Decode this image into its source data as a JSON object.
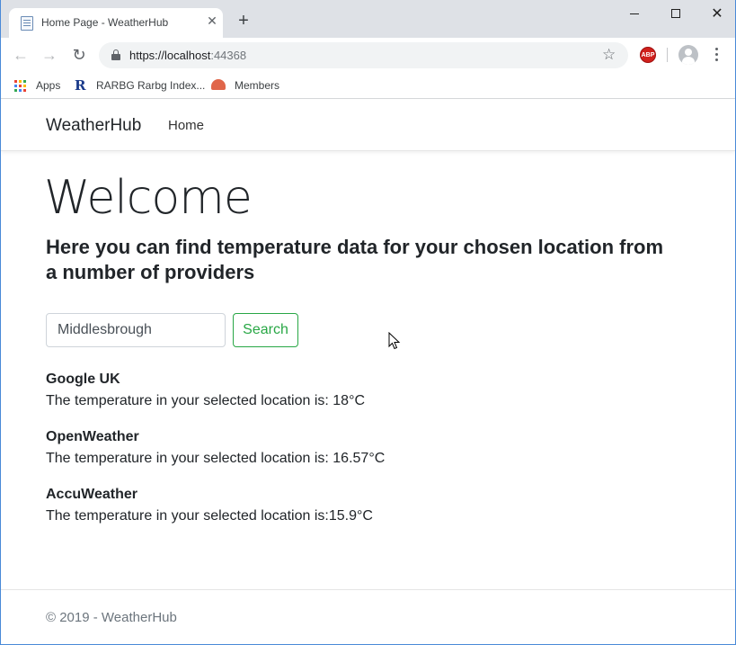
{
  "browser": {
    "tab_title": "Home Page - WeatherHub",
    "url_host": "https://localhost",
    "url_port": ":44368",
    "bookmarks": [
      {
        "label": "Apps",
        "icon": "apps-grid-icon"
      },
      {
        "label": "RARBG Rarbg Index...",
        "icon": "rarbg-icon"
      },
      {
        "label": "Members",
        "icon": "members-icon"
      }
    ],
    "extension_badge": "ABP",
    "colors": {
      "titlebar": "#dee1e6",
      "omnibox": "#f1f3f4",
      "abp": "#d0201c"
    }
  },
  "navbar": {
    "brand": "WeatherHub",
    "links": [
      {
        "label": "Home"
      }
    ]
  },
  "main": {
    "heading": "Welcome",
    "lead": "Here you can find temperature data for your chosen location from a number of providers",
    "search": {
      "value": "Middlesbrough",
      "button_label": "Search",
      "button_color": "#28a745"
    },
    "results": [
      {
        "provider": "Google UK",
        "text": "The temperature in your selected location is: 18°C"
      },
      {
        "provider": "OpenWeather",
        "text": "The temperature in your selected location is: 16.57°C"
      },
      {
        "provider": "AccuWeather",
        "text": "The temperature in your selected location is:15.9°C"
      }
    ]
  },
  "footer": {
    "text": "© 2019 - WeatherHub"
  }
}
